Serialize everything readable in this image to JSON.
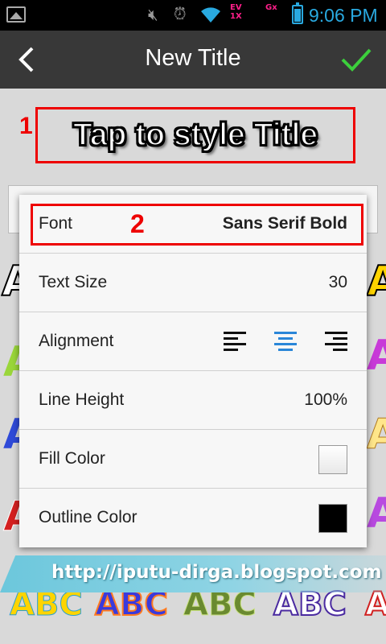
{
  "status_bar": {
    "time": "9:06 PM",
    "signal1": "EV",
    "signal1b": "1X",
    "signal2": "Gx"
  },
  "header": {
    "title": "New Title"
  },
  "preview": {
    "step_label": "1",
    "title_text": "Tap to style Title"
  },
  "style_menu": {
    "font": {
      "label": "Font",
      "value": "Sans Serif Bold",
      "step_label": "2"
    },
    "text_size": {
      "label": "Text Size",
      "value": "30"
    },
    "alignment": {
      "label": "Alignment",
      "selected": "center"
    },
    "line_height": {
      "label": "Line Height",
      "value": "100%"
    },
    "fill_color": {
      "label": "Fill Color",
      "color": "#ffffff"
    },
    "outline_color": {
      "label": "Outline Color",
      "color": "#000000"
    }
  },
  "samples": {
    "left": [
      "A",
      "A",
      "A",
      "A"
    ],
    "right": [
      "A",
      "A",
      "A",
      "A",
      "A"
    ],
    "bottom": [
      "ABC",
      "ABC",
      "ABC",
      "ABC",
      "A"
    ]
  },
  "watermark": "http://iputu-dirga.blogspot.com",
  "colors": {
    "accent": "#29a9e0",
    "check": "#3ccf3c",
    "highlight": "#e00000"
  }
}
